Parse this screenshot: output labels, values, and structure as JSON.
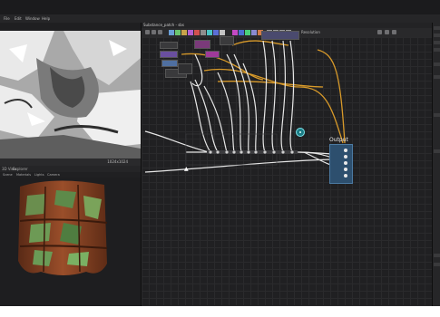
{
  "window": {
    "title": "Substance_patch - sbs"
  },
  "menubar": {
    "items": [
      "File",
      "Edit",
      "Window",
      "Help"
    ]
  },
  "graph": {
    "tab_label": "Substance_patch - sbs",
    "toolbar_label": "Resolution",
    "output_node_label": "Output"
  },
  "view2d": {
    "toolbar_value": "1024x1024"
  },
  "panels": {
    "tabs": [
      "3D View",
      "Explorer"
    ],
    "subtabs": [
      "Scene",
      "Materials",
      "Lights",
      "Camera"
    ]
  },
  "colors": {
    "output_node": "#2d4f6e",
    "wire_white": "#e6e6e6",
    "wire_orange": "#d89a2a",
    "pin_teal": "#1b7d86"
  },
  "icons": [
    "close-icon",
    "maximize-icon",
    "pin-icon",
    "cursor-icon"
  ]
}
